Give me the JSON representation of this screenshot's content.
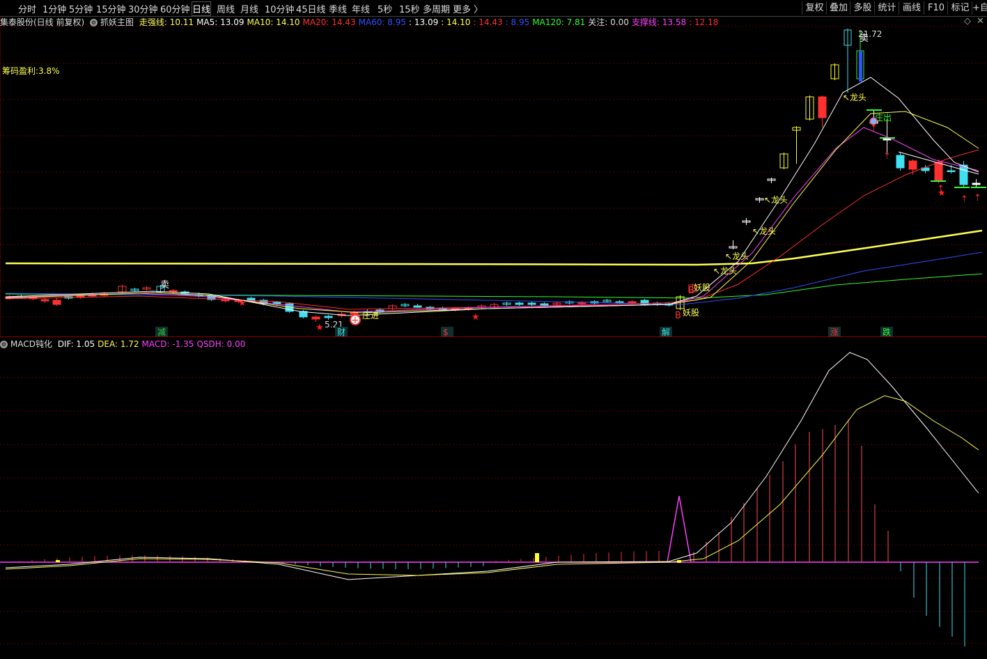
{
  "toolbar": {
    "tabs": [
      "分时",
      "1分钟",
      "5分钟",
      "15分钟",
      "30分钟",
      "60分钟",
      "日线",
      "周线",
      "月线",
      "10分钟",
      "45日线",
      "季线",
      "年线",
      "5秒",
      "15秒",
      "多周期",
      "更多 〉"
    ],
    "active_tab": "日线",
    "right_buttons": [
      "复权",
      "叠加",
      "多股",
      "统计",
      "画线",
      "F10",
      "标记",
      "+自"
    ]
  },
  "info_bar": {
    "stock_name": "集泰股份(日线 前复权)",
    "indicator_name": "抓妖主图",
    "items": [
      {
        "text": "走强线: 10.11",
        "color": "#ffff54"
      },
      {
        "text": "MA5: 13.09",
        "color": "#ffffff"
      },
      {
        "text": "MA10: 14.10",
        "color": "#ffff54"
      },
      {
        "text": "MA20: 14.43",
        "color": "#ff3030"
      },
      {
        "text": "MA60: 8.95",
        "color": "#3050ff"
      },
      {
        "text": ": 13.09",
        "color": "#ffffff"
      },
      {
        "text": ": 14.10",
        "color": "#ffff54"
      },
      {
        "text": ": 14.43",
        "color": "#ff3030"
      },
      {
        "text": ": 8.95",
        "color": "#3050ff"
      },
      {
        "text": "MA120: 7.81",
        "color": "#30ff30"
      },
      {
        "text": "关注: 0.00",
        "color": "#dddddd"
      },
      {
        "text": "支撑线: 13.58",
        "color": "#ff40ff"
      },
      {
        "text": ": 12.18",
        "color": "#ff3030"
      }
    ]
  },
  "chip_profit": "筹码盈利:3.8%",
  "price_high_label": "21.72",
  "price_low_label": "5.21",
  "signals": {
    "mai": "卖",
    "longtou": "龙头",
    "zhuangchu": "庄出",
    "zhuangjin": "庄进",
    "yaogu": "妖股",
    "b": "B"
  },
  "bottom_markers": [
    {
      "text": "减",
      "color": "#30d030"
    },
    {
      "text": "财",
      "color": "#40e0e0"
    },
    {
      "text": "$",
      "color": "#ff3030"
    },
    {
      "text": "解",
      "color": "#40e0e0"
    },
    {
      "text": "涨",
      "color": "#ff3030"
    },
    {
      "text": "跌",
      "color": "#30ff30"
    }
  ],
  "macd_bar": {
    "title": "MACD钝化",
    "items": [
      {
        "text": "DIF: 1.05",
        "color": "#ffffff"
      },
      {
        "text": "DEA: 1.72",
        "color": "#ffff54"
      },
      {
        "text": "MACD: -1.35",
        "color": "#ff40ff"
      },
      {
        "text": "QSDH: 0.00",
        "color": "#ff40ff"
      }
    ]
  },
  "colors": {
    "up": "#ff3030",
    "down": "#40e0f0",
    "ma5": "#ffffff",
    "ma10": "#ffff54",
    "ma20": "#ff3030",
    "ma60": "#3050ff",
    "ma120": "#30ff30",
    "support": "#ff40ff",
    "strong": "#ffff54",
    "grid": "#5a0000"
  }
}
